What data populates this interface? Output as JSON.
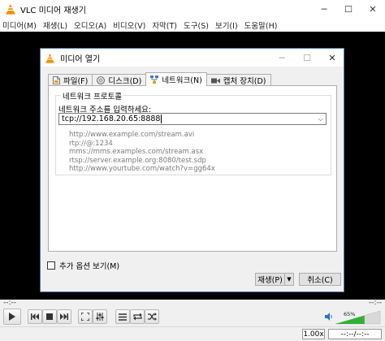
{
  "main_window": {
    "title": "VLC 미디어 재생기",
    "controls": {
      "minimize": "─",
      "maximize": "☐",
      "close": "✕"
    },
    "menu": [
      "미디어(M)",
      "재생(L)",
      "오디오(A)",
      "비디오(V)",
      "자막(T)",
      "도구(S)",
      "보기(I)",
      "도움말(H)"
    ]
  },
  "dialog": {
    "title": "미디어 열기",
    "controls": {
      "minimize": "─",
      "maximize": "☐",
      "close": "✕"
    },
    "tabs": [
      {
        "label": "파일(F)",
        "icon": "file-icon",
        "active": false
      },
      {
        "label": "디스크(D)",
        "icon": "disc-icon",
        "active": false
      },
      {
        "label": "네트워크(N)",
        "icon": "network-icon",
        "active": true
      },
      {
        "label": "캡처 장치(D)",
        "icon": "capture-device-icon",
        "active": false
      }
    ],
    "network_group_label": "네트워크 프로토콜",
    "url_label": "네트워크 주소를 입력하세요:",
    "url_value": "tcp://192.168.20.65:8888",
    "examples": [
      "http://www.example.com/stream.avi",
      "rtp://@:1234",
      "mms://mms.examples.com/stream.asx",
      "rtsp://server.example.org:8080/test.sdp",
      "http://www.yourtube.com/watch?v=gg64x"
    ],
    "more_options_label": "추가 옵션 보기(M)",
    "more_options_checked": false,
    "play_button_label": "재생(P)",
    "cancel_button_label": "취소(C)"
  },
  "player": {
    "elapsed": "--:--",
    "remaining": "--:--",
    "volume_percent": 65,
    "volume_label": "65%",
    "speed": "1.00x",
    "time_display": "--:--/--:--",
    "accent_color": "#2fb135"
  }
}
